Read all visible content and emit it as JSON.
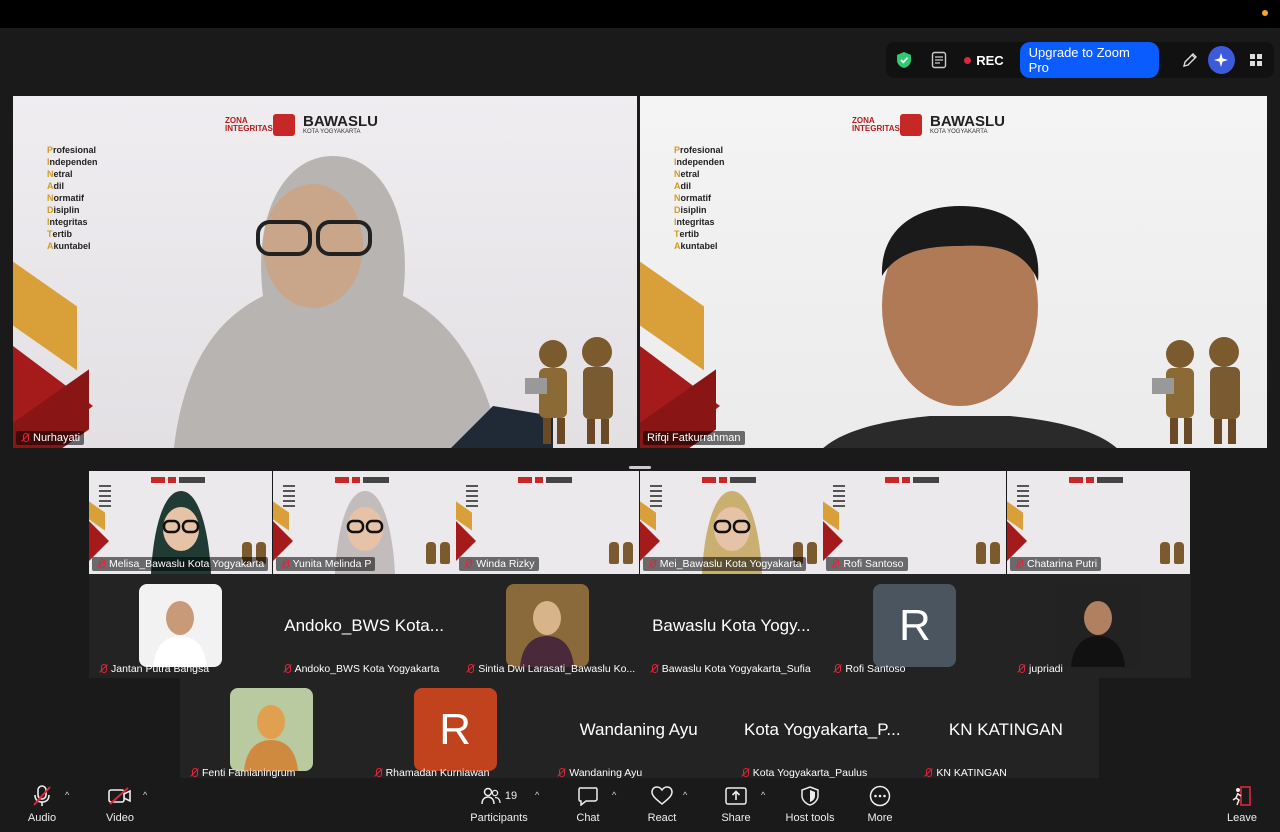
{
  "top_toolbar": {
    "rec_label": "REC",
    "upgrade_label": "Upgrade to Zoom Pro"
  },
  "speakers": [
    {
      "name": "Nurhayati",
      "muted": true
    },
    {
      "name": "Rifqi Fatkurrahman",
      "muted": false,
      "active": true
    }
  ],
  "background": {
    "brand": "BAWASLU",
    "brand_sub": "KOTA YOGYAKARTA",
    "zona": "ZONA INTEGRITAS",
    "acronym": [
      {
        "first": "P",
        "rest": "rofesional"
      },
      {
        "first": "I",
        "rest": "ndependen"
      },
      {
        "first": "N",
        "rest": "etral"
      },
      {
        "first": "A",
        "rest": "dil"
      },
      {
        "first": "N",
        "rest": "ormatif"
      },
      {
        "first": "D",
        "rest": "isiplin"
      },
      {
        "first": "I",
        "rest": "ntegritas"
      },
      {
        "first": "T",
        "rest": "ertib"
      },
      {
        "first": "A",
        "rest": "kuntabel"
      }
    ]
  },
  "video_strip": [
    {
      "name": "Melisa_Bawaslu Kota Yogyakarta"
    },
    {
      "name": "Yunita Melinda P"
    },
    {
      "name": "Winda Rizky"
    },
    {
      "name": "Mei_Bawaslu Kota Yogyakarta"
    },
    {
      "name": "Rofi Santoso"
    },
    {
      "name": "Chatarina Putri"
    }
  ],
  "gallery_row2": [
    {
      "name": "Jantan Putra Bangsa",
      "display": "",
      "kind": "photo"
    },
    {
      "name": "Andoko_BWS Kota Yogyakarta",
      "display": "Andoko_BWS Kota...",
      "kind": "text"
    },
    {
      "name": "Sintia Dwi Larasati_Bawaslu Ko...",
      "display": "",
      "kind": "photo"
    },
    {
      "name": "Bawaslu Kota Yogyakarta_Sufia",
      "display": "Bawaslu Kota Yogy...",
      "kind": "text"
    },
    {
      "name": "Rofi Santoso",
      "display": "R",
      "kind": "letter",
      "color": "#4a5560"
    },
    {
      "name": "jupriadi",
      "display": "",
      "kind": "photo"
    }
  ],
  "gallery_row3": [
    {
      "name": "Fenti Famianingrum",
      "display": "",
      "kind": "photo"
    },
    {
      "name": "Rhamadan Kurniawan",
      "display": "R",
      "kind": "letter",
      "color": "#c0431d"
    },
    {
      "name": "Wandaning Ayu",
      "display": "Wandaning Ayu",
      "kind": "text"
    },
    {
      "name": "Kota Yogyakarta_Paulus",
      "display": "Kota Yogyakarta_P...",
      "kind": "text"
    },
    {
      "name": "KN KATINGAN",
      "display": "KN KATINGAN",
      "kind": "text"
    }
  ],
  "bottom_bar": {
    "audio": "Audio",
    "video": "Video",
    "participants": "Participants",
    "participants_count": "19",
    "chat": "Chat",
    "react": "React",
    "share": "Share",
    "host_tools": "Host tools",
    "more": "More",
    "leave": "Leave"
  },
  "colors": {
    "accent": "#0b5cff",
    "active_border": "#3fbf3f",
    "rec": "#e0263a",
    "brand_red": "#c62828",
    "brand_gold": "#d9a03a"
  }
}
